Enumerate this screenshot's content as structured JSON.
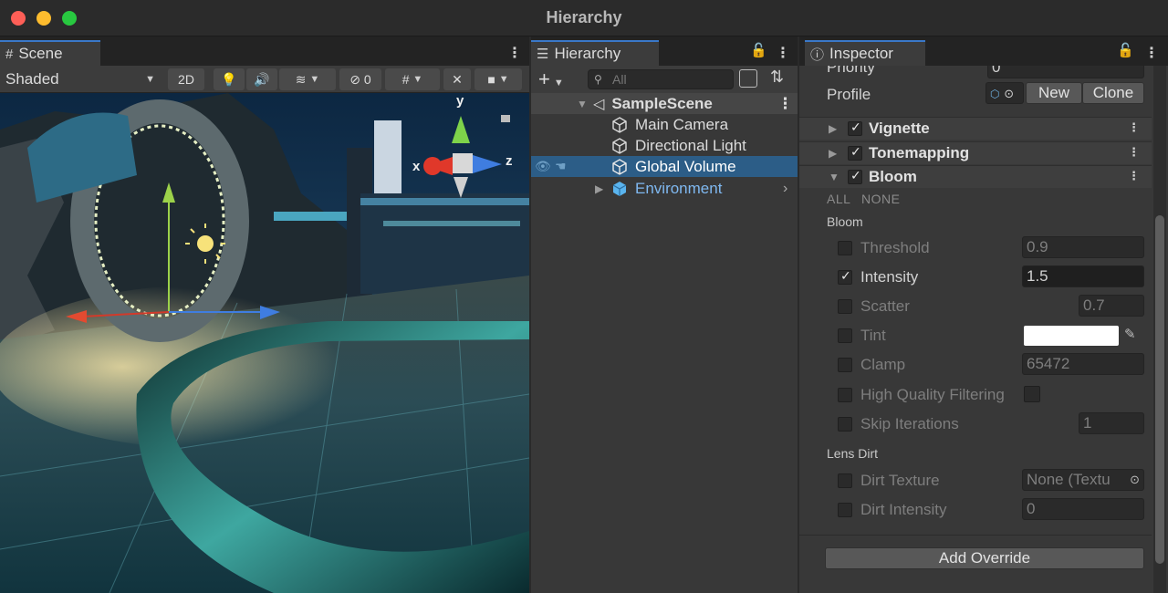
{
  "window": {
    "title": "Hierarchy"
  },
  "scene": {
    "tab_label": "Scene",
    "shading_mode": "Shaded",
    "btn_2d": "2D",
    "hidden_count": "0",
    "gizmo": {
      "x": "x",
      "y": "y",
      "z": "z"
    }
  },
  "hierarchy": {
    "tab_label": "Hierarchy",
    "search_placeholder": "All",
    "items": [
      {
        "label": "SampleScene"
      },
      {
        "label": "Main Camera"
      },
      {
        "label": "Directional Light"
      },
      {
        "label": "Global Volume"
      },
      {
        "label": "Environment"
      }
    ]
  },
  "inspector": {
    "tab_label": "Inspector",
    "priority_label": "Priority",
    "priority_value": "0",
    "profile_label": "Profile",
    "new_button": "New",
    "clone_button": "Clone",
    "sections": [
      {
        "title": "Vignette",
        "enabled": true
      },
      {
        "title": "Tonemapping",
        "enabled": true
      },
      {
        "title": "Bloom",
        "enabled": true
      }
    ],
    "all_link": "ALL",
    "none_link": "NONE",
    "bloom_header": "Bloom",
    "fields": [
      {
        "label": "Threshold",
        "value": "0.9",
        "override": false
      },
      {
        "label": "Intensity",
        "value": "1.5",
        "override": true
      },
      {
        "label": "Scatter",
        "value": "0.7",
        "override": false
      },
      {
        "label": "Tint",
        "value": "",
        "override": false
      },
      {
        "label": "Clamp",
        "value": "65472",
        "override": false
      },
      {
        "label": "High Quality Filtering",
        "value": "",
        "override": false
      },
      {
        "label": "Skip Iterations",
        "value": "1",
        "override": false
      }
    ],
    "lens_dirt_header": "Lens Dirt",
    "dirt_fields": [
      {
        "label": "Dirt Texture",
        "value": "None (Textu",
        "override": false
      },
      {
        "label": "Dirt Intensity",
        "value": "0",
        "override": false
      }
    ],
    "add_override": "Add Override"
  },
  "colors": {
    "selection": "#2c5d87",
    "accent_tab": "#3a78c8",
    "environment_text": "#7fb8f0"
  }
}
